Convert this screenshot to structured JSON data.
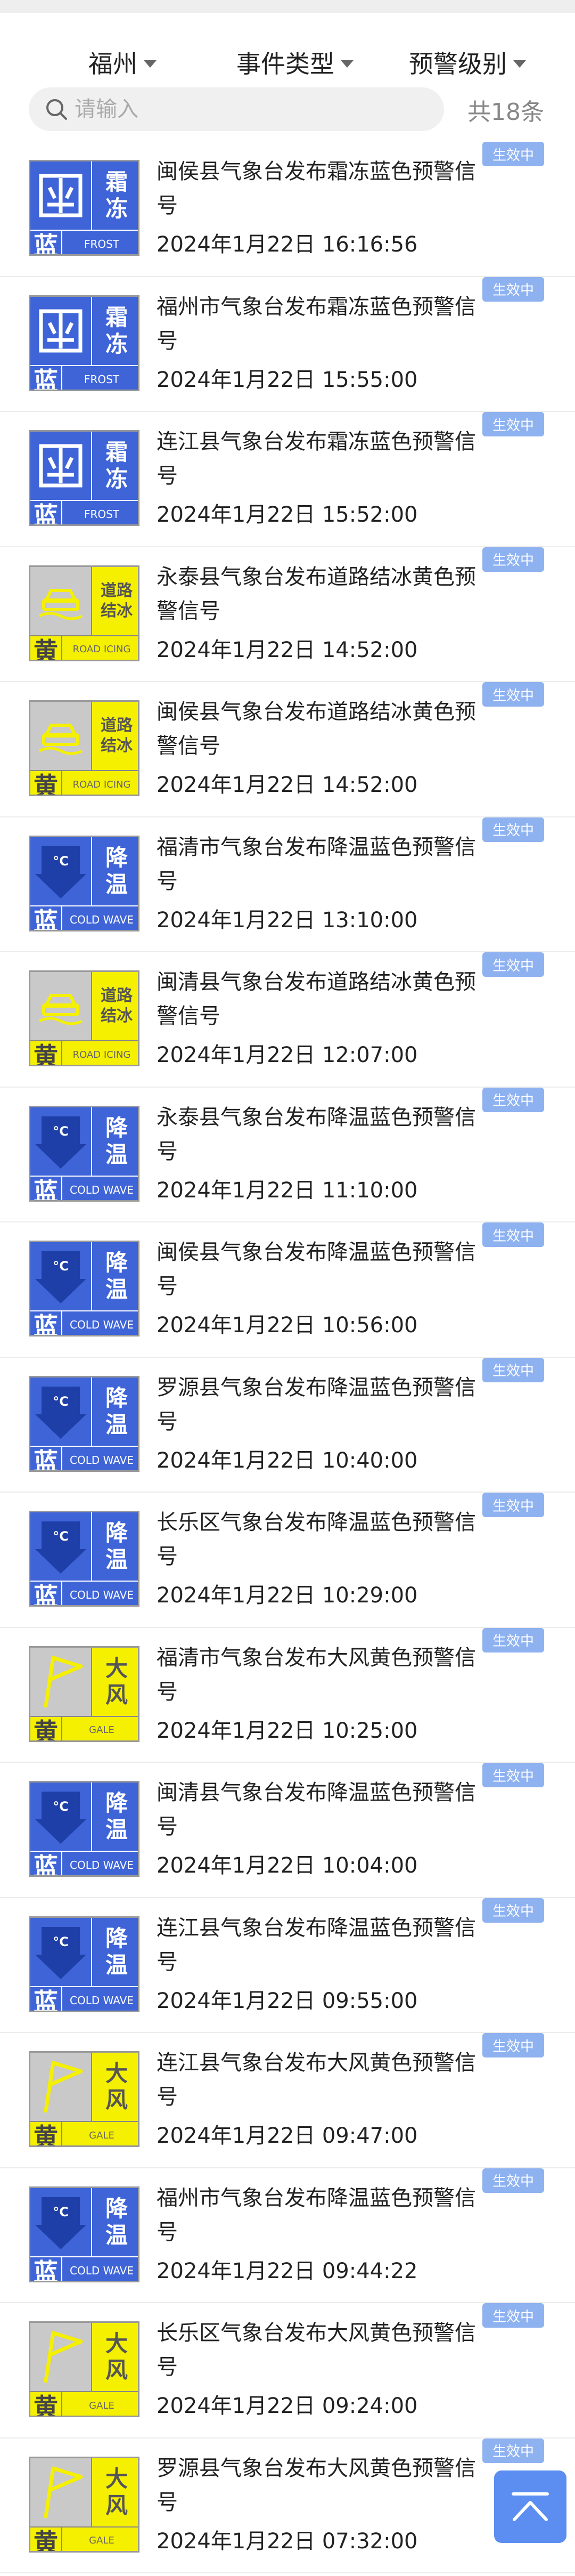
{
  "filters": {
    "region": "福州",
    "event_type": "事件类型",
    "level": "预警级别"
  },
  "search": {
    "placeholder": "请输入",
    "count_text": "共18条"
  },
  "colors": {
    "blue_signal": "#3e64d8",
    "yellow_signal": "#f5f000",
    "badge": "#8eb1f0",
    "back_to_top": "#5b8ef0"
  },
  "icon_labels": {
    "frost": {
      "line1": "霜",
      "line2": "冻",
      "en": "FROST"
    },
    "road_icing": {
      "line1": "道路",
      "line2": "结冰",
      "en": "ROAD ICING"
    },
    "cold_wave": {
      "line1": "降",
      "line2": "温",
      "en": "COLD WAVE"
    },
    "gale": {
      "line1": "大",
      "line2": "风",
      "en": "GALE"
    },
    "level_blue": "蓝",
    "level_yellow": "黄",
    "celsius": "°C"
  },
  "alerts": [
    {
      "title": "闽侯县气象台发布霜冻蓝色预警信号",
      "time": "2024年1月22日 16:16:56",
      "status": "生效中"
    },
    {
      "title": "福州市气象台发布霜冻蓝色预警信号",
      "time": "2024年1月22日 15:55:00",
      "status": "生效中"
    },
    {
      "title": "连江县气象台发布霜冻蓝色预警信号",
      "time": "2024年1月22日 15:52:00",
      "status": "生效中"
    },
    {
      "title": "永泰县气象台发布道路结冰黄色预警信号",
      "time": "2024年1月22日 14:52:00",
      "status": "生效中"
    },
    {
      "title": "闽侯县气象台发布道路结冰黄色预警信号",
      "time": "2024年1月22日 14:52:00",
      "status": "生效中"
    },
    {
      "title": "福清市气象台发布降温蓝色预警信号",
      "time": "2024年1月22日 13:10:00",
      "status": "生效中"
    },
    {
      "title": "闽清县气象台发布道路结冰黄色预警信号",
      "time": "2024年1月22日 12:07:00",
      "status": "生效中"
    },
    {
      "title": "永泰县气象台发布降温蓝色预警信号",
      "time": "2024年1月22日 11:10:00",
      "status": "生效中"
    },
    {
      "title": "闽侯县气象台发布降温蓝色预警信号",
      "time": "2024年1月22日 10:56:00",
      "status": "生效中"
    },
    {
      "title": "罗源县气象台发布降温蓝色预警信号",
      "time": "2024年1月22日 10:40:00",
      "status": "生效中"
    },
    {
      "title": "长乐区气象台发布降温蓝色预警信号",
      "time": "2024年1月22日 10:29:00",
      "status": "生效中"
    },
    {
      "title": "福清市气象台发布大风黄色预警信号",
      "time": "2024年1月22日 10:25:00",
      "status": "生效中"
    },
    {
      "title": "闽清县气象台发布降温蓝色预警信号",
      "time": "2024年1月22日 10:04:00",
      "status": "生效中"
    },
    {
      "title": "连江县气象台发布降温蓝色预警信号",
      "time": "2024年1月22日 09:55:00",
      "status": "生效中"
    },
    {
      "title": "连江县气象台发布大风黄色预警信号",
      "time": "2024年1月22日 09:47:00",
      "status": "生效中"
    },
    {
      "title": "福州市气象台发布降温蓝色预警信号",
      "time": "2024年1月22日 09:44:22",
      "status": "生效中"
    },
    {
      "title": "长乐区气象台发布大风黄色预警信号",
      "time": "2024年1月22日 09:24:00",
      "status": "生效中"
    },
    {
      "title": "罗源县气象台发布大风黄色预警信号",
      "time": "2024年1月22日 07:32:00",
      "status": "生效中"
    }
  ]
}
